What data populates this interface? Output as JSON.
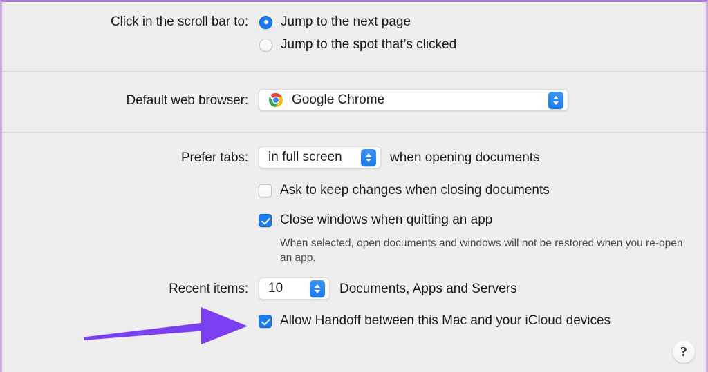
{
  "window": {
    "accent_border_color": "#a97fd0",
    "background_color": "#eeeeee",
    "control_accent_color": "#1a7ced",
    "annotation_arrow_color": "#7b3ff2"
  },
  "scroll_bar_section": {
    "label": "Click in the scroll bar to:",
    "options": [
      {
        "label": "Jump to the next page",
        "selected": true
      },
      {
        "label": "Jump to the spot that’s clicked",
        "selected": false
      }
    ]
  },
  "default_browser_section": {
    "label": "Default web browser:",
    "value": "Google Chrome",
    "icon": "chrome-icon",
    "stepper_icon": "up-down-chevron-icon"
  },
  "documents_section": {
    "prefer_tabs": {
      "label": "Prefer tabs:",
      "value": "in full screen",
      "suffix": "when opening documents",
      "stepper_icon": "up-down-chevron-icon"
    },
    "ask_keep_changes": {
      "label": "Ask to keep changes when closing documents",
      "checked": false
    },
    "close_windows": {
      "label": "Close windows when quitting an app",
      "checked": true
    },
    "close_windows_help": "When selected, open documents and windows will not be restored when you re-open an app.",
    "recent_items": {
      "label": "Recent items:",
      "value": "10",
      "suffix": "Documents, Apps and Servers",
      "stepper_icon": "up-down-chevron-icon"
    },
    "handoff": {
      "label": "Allow Handoff between this Mac and your iCloud devices",
      "checked": true
    }
  },
  "help_button": {
    "glyph": "?",
    "icon": "question-mark-icon"
  }
}
